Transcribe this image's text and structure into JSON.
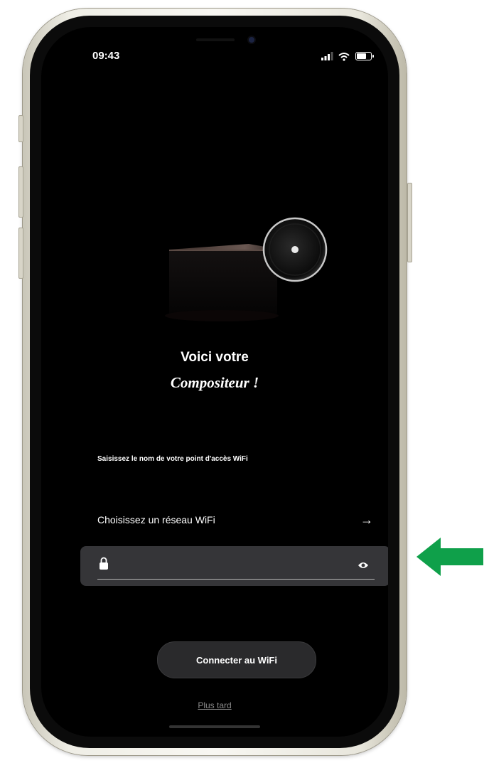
{
  "status_bar": {
    "time": "09:43",
    "icons": [
      "signal-icon",
      "wifi-icon",
      "battery-icon"
    ]
  },
  "device_image": {
    "name": "compositeur-device-illustration"
  },
  "title": {
    "line1": "Voici votre",
    "line2": "Compositeur !"
  },
  "prompt": "Saisissez le nom de votre point d'accès WiFi",
  "wifi_select": {
    "label": "Choisissez un réseau WiFi",
    "arrow": "→"
  },
  "password_field": {
    "value": "",
    "left_icon": "lock-icon",
    "right_icon": "eye-icon"
  },
  "connect_button": {
    "label": "Connecter au WiFi"
  },
  "later_link": {
    "label": "Plus tard"
  },
  "colors": {
    "screen_background": "#000000",
    "field_background": "#353538",
    "button_background": "#2a2a2c",
    "annotation_arrow": "#0fa04a"
  }
}
